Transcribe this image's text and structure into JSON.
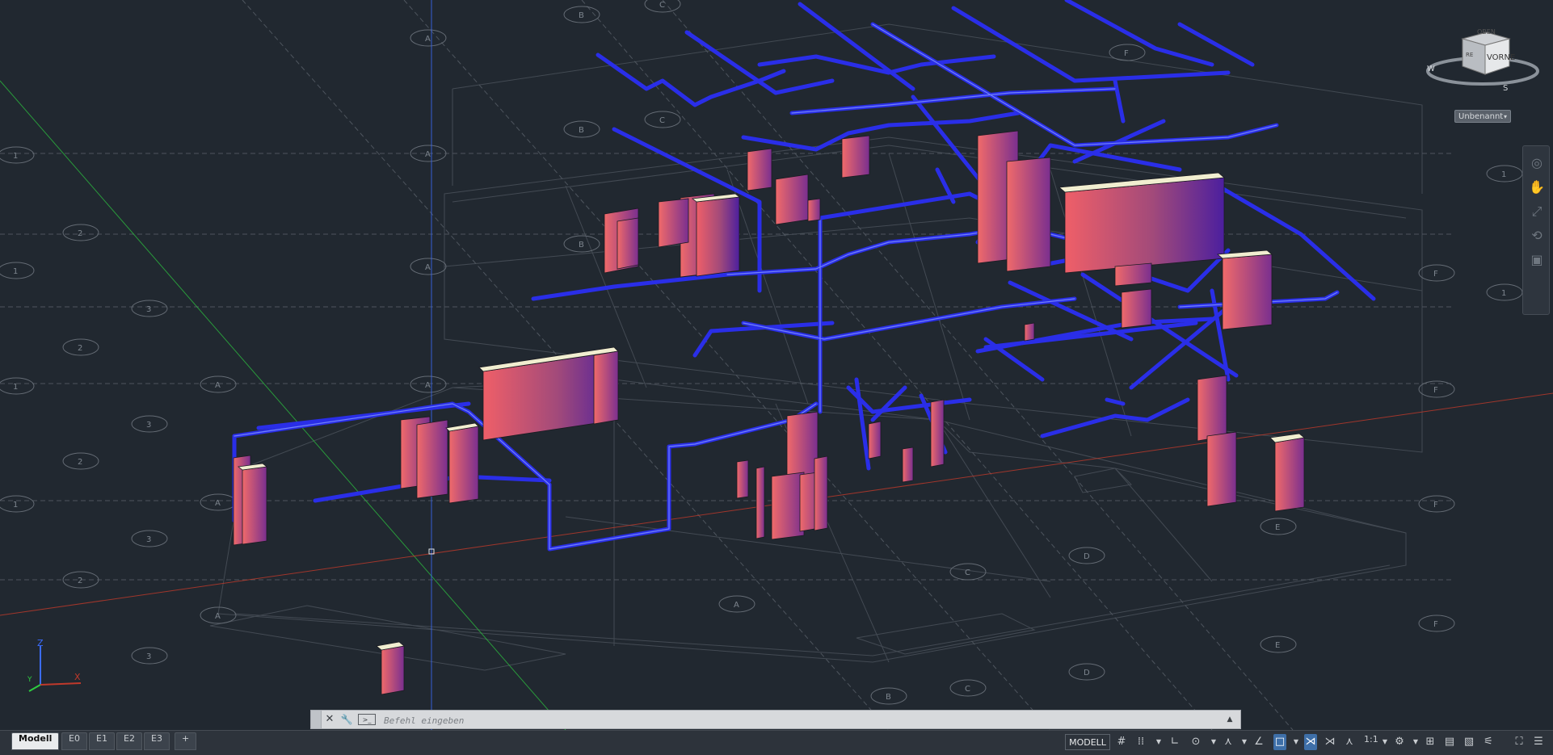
{
  "app": {
    "named_view": "Unbenannt"
  },
  "viewcube": {
    "face_top": "OBEN",
    "face_front": "VORNE",
    "face_side": "RE",
    "compass": [
      "W",
      "S"
    ]
  },
  "ucs": {
    "x": "X",
    "y": "Y",
    "z": "Z"
  },
  "grid_labels": {
    "letters": [
      "A",
      "B",
      "C",
      "D",
      "E",
      "F"
    ],
    "numbers": [
      "1",
      "2",
      "3"
    ]
  },
  "commandline": {
    "placeholder": "Befehl eingeben",
    "prompt_icon": ">_",
    "close_icon": "✕",
    "settings_icon": "🔧",
    "history_icon": "▲"
  },
  "layout_tabs": [
    "Modell",
    "E0",
    "E1",
    "E2",
    "E3"
  ],
  "add_layout": "+",
  "statusbar": {
    "model_label": "MODELL",
    "scale": "1:1"
  },
  "colors": {
    "background": "#212830",
    "pipe": "#2a2ee8",
    "pipe_highlight": "#8aa0ff",
    "equipment_left": "#ef5f68",
    "equipment_right": "#4c1f9e",
    "equipment_top": "#f1eed0",
    "x_axis": "#c0392b",
    "y_axis": "#2ecc40",
    "z_axis": "#3b6cff"
  }
}
